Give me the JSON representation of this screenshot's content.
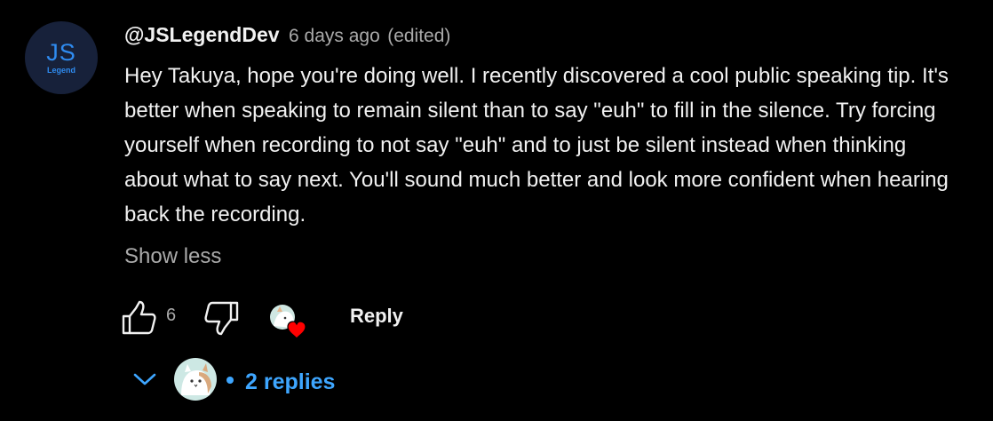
{
  "comment": {
    "avatar_text": "JS",
    "avatar_subtext": "Legend",
    "author": "@JSLegendDev",
    "timestamp": "6 days ago",
    "edited": "(edited)",
    "body": "Hey Takuya, hope you're doing well. I recently discovered a cool public speaking tip. It's better when speaking to remain silent than to say \"euh\" to fill in the silence. Try forcing yourself when recording to not say \"euh\" and to just be silent instead when thinking about what to say next. You'll sound much better and look more confident when hearing back the recording.",
    "show_less": "Show less",
    "like_count": "6",
    "reply_label": "Reply",
    "replies_label": "2 replies"
  },
  "colors": {
    "background": "#000000",
    "link_blue": "#3ea6ff",
    "secondary_text": "#aaaaaa",
    "heart_red": "#ff0000"
  },
  "icons": [
    "thumbs-up-icon",
    "thumbs-down-icon",
    "creator-heart-icon",
    "chevron-down-icon"
  ]
}
